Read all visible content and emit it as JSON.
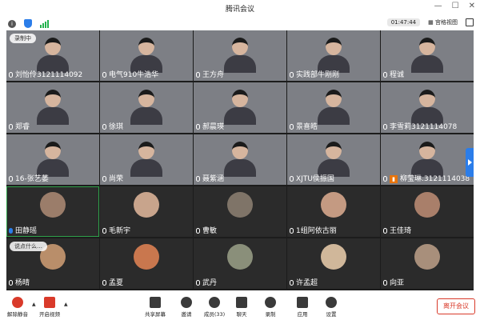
{
  "app": {
    "title": "腾讯会议"
  },
  "toolbar": {
    "timer": "01:47:44",
    "view_label": "宫格视图",
    "colors": {
      "accent": "#2b7de9",
      "leave": "#d93a2a",
      "speaking": "#2fa14a"
    }
  },
  "participants": [
    {
      "name": "刘怡伶3121114092",
      "overlay": "录制中"
    },
    {
      "name": "电气910牛浩华"
    },
    {
      "name": "王方舟"
    },
    {
      "name": "实践部牛刚刚"
    },
    {
      "name": "程诚"
    },
    {
      "name": "郑睿"
    },
    {
      "name": "徐琪"
    },
    {
      "name": "郝晨瑛"
    },
    {
      "name": "景喜皓"
    },
    {
      "name": "李雪莉3121114078"
    },
    {
      "name": "16-张艺萎"
    },
    {
      "name": "尚荣"
    },
    {
      "name": "聂紫涵"
    },
    {
      "name": "XJTU侯振国"
    },
    {
      "name": "柳莹琳.3121114038"
    },
    {
      "name": "田静瑶"
    },
    {
      "name": "毛新宇"
    },
    {
      "name": "曹敏"
    },
    {
      "name": "1组阿依古丽"
    },
    {
      "name": "王佳琦"
    },
    {
      "name": "杨晴",
      "overlay": "说点什么…"
    },
    {
      "name": "孟夏"
    },
    {
      "name": "武丹"
    },
    {
      "name": "许孟超"
    },
    {
      "name": "向亚"
    }
  ],
  "bottom": {
    "mute": "解除静音",
    "video": "开启视频",
    "share": "共享屏幕",
    "invite": "邀请",
    "members": "成员(33)",
    "chat": "聊天",
    "record": "录制",
    "apps": "应用",
    "settings": "设置",
    "leave": "离开会议"
  }
}
